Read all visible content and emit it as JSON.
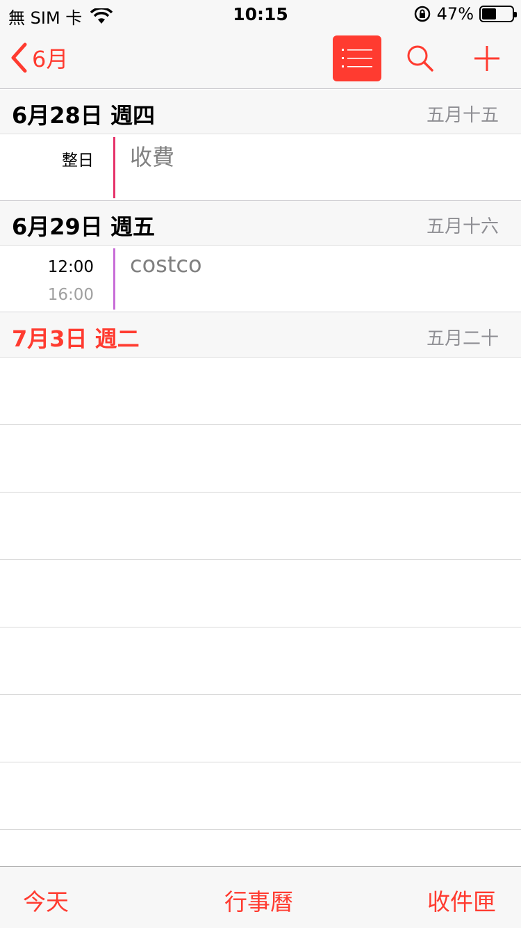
{
  "status_bar": {
    "carrier": "無 SIM 卡",
    "time": "10:15",
    "battery_percent": "47%",
    "battery_level": 0.47
  },
  "nav": {
    "back_label": "6月"
  },
  "sections": [
    {
      "date": "6月28日 週四",
      "lunar": "五月十五",
      "events": [
        {
          "time_start": "整日",
          "time_end": "",
          "title": "收費",
          "color": "#e6336a"
        }
      ]
    },
    {
      "date": "6月29日 週五",
      "lunar": "五月十六",
      "events": [
        {
          "time_start": "12:00",
          "time_end": "16:00",
          "title": "costco",
          "color": "#c86dd7"
        }
      ]
    },
    {
      "date": "7月3日 週二",
      "lunar": "五月二十",
      "events": []
    }
  ],
  "tabs": {
    "today": "今天",
    "calendars": "行事曆",
    "inbox": "收件匣"
  },
  "colors": {
    "accent": "#ff3b30",
    "header_bg": "#f7f7f7"
  }
}
